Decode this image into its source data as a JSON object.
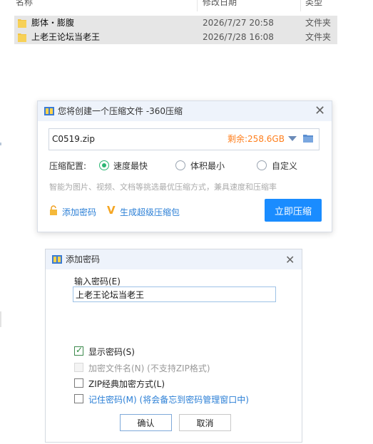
{
  "explorer": {
    "columns": {
      "name": "名称",
      "date": "修改日期",
      "type": "类型"
    },
    "rows": [
      {
        "name": "膨体・膨腹",
        "date": "2026/7/27 20:58",
        "type": "文件夹"
      },
      {
        "name": "上老王论坛当老王",
        "date": "2026/7/28 16:08",
        "type": "文件夹"
      }
    ]
  },
  "zip_dialog": {
    "title": "您将创建一个压缩文件 -360压缩",
    "filename": "C0519.zip",
    "free_space": "剩余:258.6GB",
    "config_label": "压缩配置:",
    "options": [
      "速度最快",
      "体积最小",
      "自定义"
    ],
    "selected_option": "速度最快",
    "hint": "智能为图片、视频、文档等挑选最优压缩方式，兼具速度和压缩率",
    "add_password_link": "添加密码",
    "super_zip_link": "生成超级压缩包",
    "compress_button": "立即压缩"
  },
  "password_dialog": {
    "title": "添加密码",
    "input_label": "输入密码(E)",
    "password_value": "上老王论坛当老王",
    "options": [
      {
        "label": "显示密码(S)",
        "checked": true,
        "enabled": true
      },
      {
        "label": "加密文件名(N) (不支持ZIP格式)",
        "checked": false,
        "enabled": false
      },
      {
        "label": "ZIP经典加密方式(L)",
        "checked": false,
        "enabled": true
      },
      {
        "label": "记住密码(M) (将会备忘到密码管理窗口中)",
        "checked": false,
        "enabled": true
      }
    ],
    "ok_button": "确认",
    "cancel_button": "取消"
  },
  "colors": {
    "accent_blue": "#1a8cff",
    "free_space_orange": "#ff7e1b",
    "radio_green": "#2bb673",
    "link_blue": "#2b7fd6"
  },
  "icons": [
    "folder-icon",
    "zip-app-icon",
    "close-icon",
    "dropdown-arrow-icon",
    "browse-folder-icon",
    "lock-icon",
    "v-badge-icon",
    "checkmark-icon"
  ]
}
